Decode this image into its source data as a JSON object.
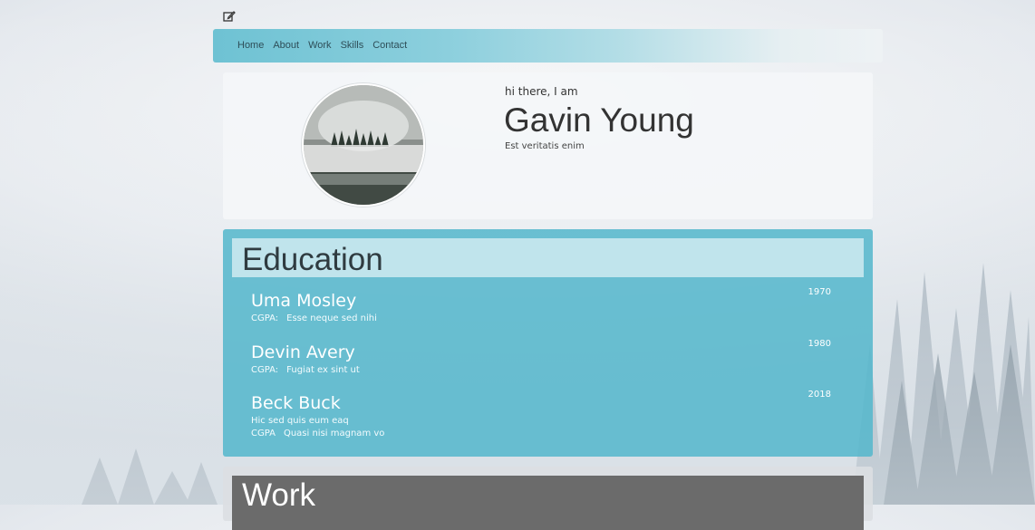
{
  "nav": {
    "items": [
      "Home",
      "About",
      "Work",
      "Skills",
      "Contact"
    ]
  },
  "profile": {
    "greeting": "hi there, I am",
    "name": "Gavin Young",
    "tagline": "Est veritatis enim"
  },
  "education": {
    "title": "Education",
    "items": [
      {
        "name": "Uma Mosley",
        "year": "1970",
        "cgpa_label": "CGPA:",
        "cgpa_value": "Esse neque sed nihi"
      },
      {
        "name": "Devin Avery",
        "year": "1980",
        "cgpa_label": "CGPA:",
        "cgpa_value": "Fugiat ex sint ut"
      },
      {
        "name": "Beck Buck",
        "year": "2018",
        "description": "Hic sed quis eum eaq",
        "cgpa_label": "CGPA",
        "cgpa_value": "Quasi nisi magnam vo"
      }
    ]
  },
  "work": {
    "title": "Work"
  },
  "colors": {
    "accent": "#54b7cc",
    "nav_gradient_start": "#6ec2d3",
    "title_bar_light": "#d6eef3",
    "work_title_bar": "#6b6b6b"
  },
  "icons": {
    "edit": "edit-icon"
  }
}
